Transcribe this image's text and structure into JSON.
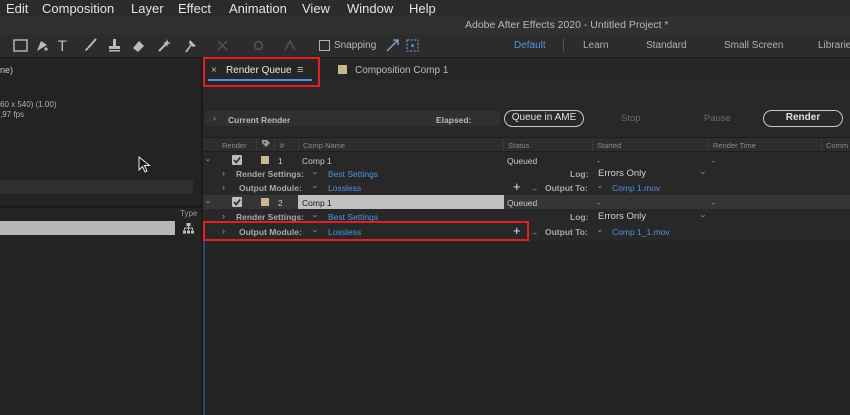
{
  "menu": [
    "Edit",
    "Composition",
    "Layer",
    "Effect",
    "Animation",
    "View",
    "Window",
    "Help"
  ],
  "app_title": "Adobe After Effects 2020 - Untitled Project *",
  "toolbar": {
    "snapping_label": "Snapping",
    "workspaces": [
      "Default",
      "Learn",
      "Standard",
      "Small Screen",
      "Librarie"
    ],
    "active_workspace": "Default"
  },
  "left_panel": {
    "line1": "ne)",
    "line2": "60 x 540) (1.00)",
    "line3": ",97 fps",
    "type_header": "Type"
  },
  "tabs": {
    "render_queue": "Render Queue",
    "composition": "Composition Comp 1"
  },
  "controls": {
    "current_render": "Current Render",
    "elapsed": "Elapsed:",
    "queue_in_ame": "Queue in AME",
    "stop": "Stop",
    "pause": "Pause",
    "render": "Render"
  },
  "columns": {
    "render": "Render",
    "hash": "#",
    "comp_name": "Comp Name",
    "status": "Status",
    "started": "Started",
    "render_time": "Render Time",
    "comment": "Comm"
  },
  "items": [
    {
      "index": "1",
      "comp_name": "Comp 1",
      "status": "Queued",
      "started": "-",
      "render_time": "-",
      "render_settings_label": "Render Settings:",
      "render_settings_value": "Best Settings",
      "log_label": "Log:",
      "log_value": "Errors Only",
      "output_module_label": "Output Module:",
      "output_module_value": "Lossless",
      "output_to_label": "Output To:",
      "output_to_value": "Comp 1.mov"
    },
    {
      "index": "2",
      "comp_name": "Comp 1",
      "status": "Queued",
      "started": "-",
      "render_time": "-",
      "render_settings_label": "Render Settings:",
      "render_settings_value": "Best Settings",
      "log_label": "Log:",
      "log_value": "Errors Only",
      "output_module_label": "Output Module:",
      "output_module_value": "Lossless",
      "output_to_label": "Output To:",
      "output_to_value": "Comp 1_1.mov"
    }
  ],
  "colors": {
    "highlight_box": "#e01f26",
    "link": "#4d95e0",
    "active_workspace": "#4d95e0"
  }
}
